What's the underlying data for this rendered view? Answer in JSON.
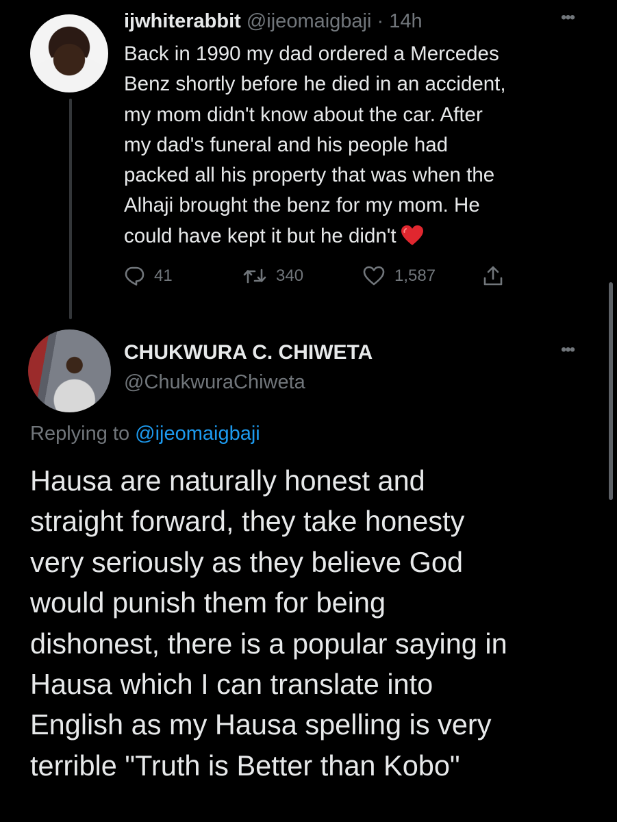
{
  "tweet1": {
    "name": "ijwhiterabbit",
    "handle": "@ijeomaigbaji",
    "separator": "·",
    "time": "14h",
    "lines": [
      "Back in 1990 my dad ordered a Mercedes",
      "Benz shortly before he died in an accident,",
      "my mom didn't know about the car. After",
      "my dad's funeral and his people had",
      "packed all his property that was when the",
      "Alhaji brought the benz for my mom. He",
      "could have kept it but he didn't"
    ],
    "emoji": "heart",
    "replies": "41",
    "retweets": "340",
    "likes": "1,587"
  },
  "tweet2": {
    "name": "CHUKWURA C. CHIWETA",
    "handle": "@ChukwuraChiweta",
    "replying_prefix": "Replying to",
    "replying_to": "@ijeomaigbaji",
    "lines": [
      "Hausa are naturally honest and",
      "straight forward, they take honesty",
      "very seriously as they believe God",
      "would punish them for being",
      "dishonest, there is a popular saying in",
      "Hausa which I can translate into",
      "English as my Hausa spelling is very",
      "terrible  \"Truth is Better than Kobo\""
    ]
  },
  "icons": {
    "more": "more-options-icon",
    "reply": "reply-icon",
    "retweet": "retweet-icon",
    "like": "like-icon",
    "share": "share-icon"
  },
  "colors": {
    "background": "#000000",
    "text": "#e7e9ea",
    "secondary": "#71767b",
    "link": "#1d9bf0",
    "heart": "#f91880"
  }
}
